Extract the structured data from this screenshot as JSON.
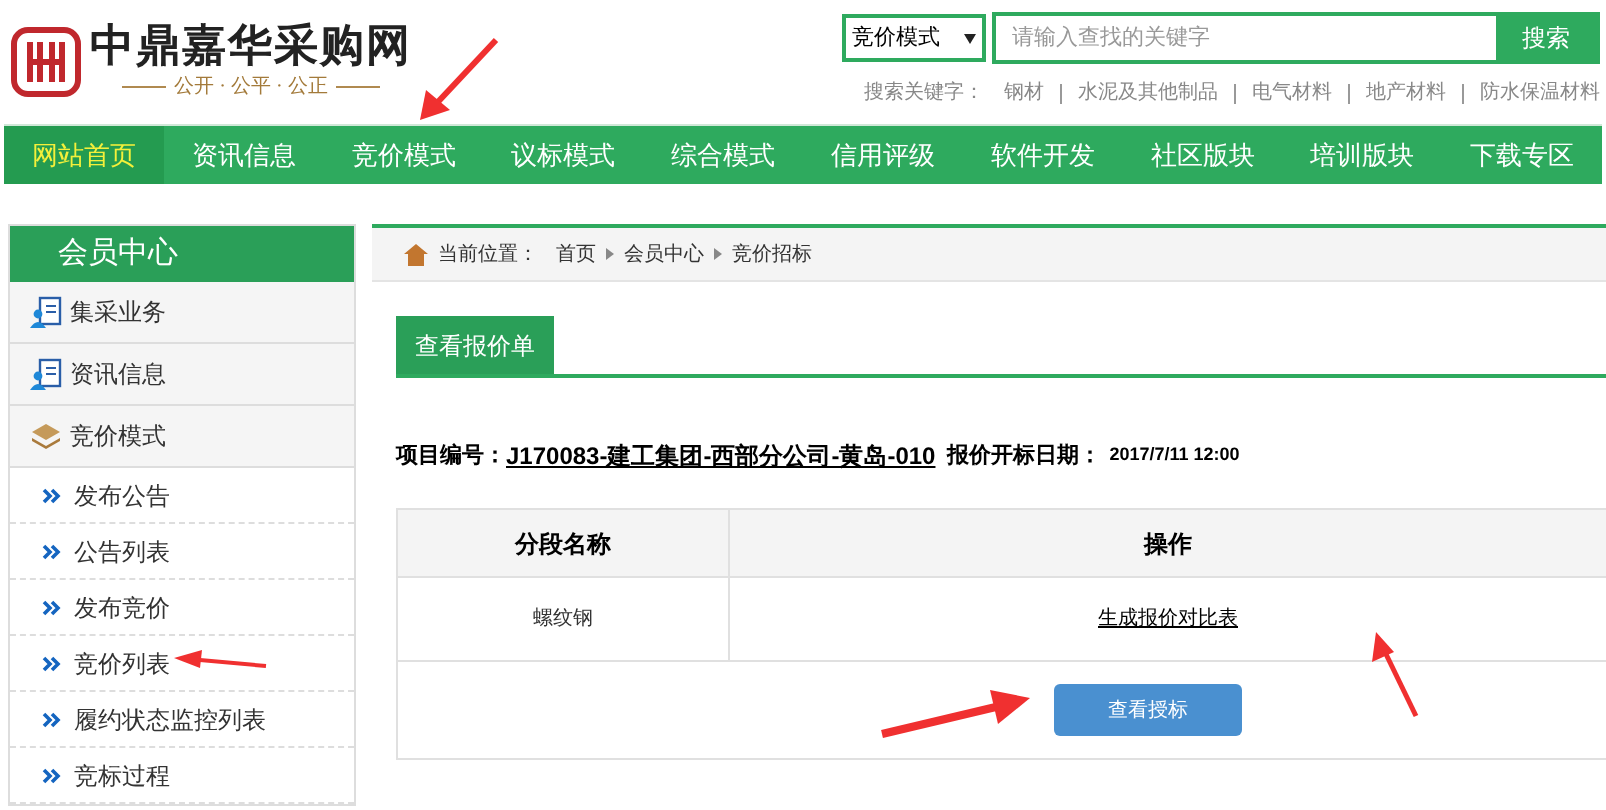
{
  "header": {
    "logo_text": "中鼎嘉华采购网",
    "slogan": "公开 · 公平 · 公正"
  },
  "search": {
    "mode": "竞价模式",
    "placeholder": "请输入查找的关键字",
    "button": "搜索",
    "keywords_label": "搜索关键字：",
    "keywords": [
      "钢材",
      "水泥及其他制品",
      "电气材料",
      "地产材料",
      "防水保温材料"
    ]
  },
  "nav": [
    {
      "label": "网站首页",
      "selected": true
    },
    {
      "label": "资讯信息",
      "selected": false
    },
    {
      "label": "竞价模式",
      "selected": false
    },
    {
      "label": "议标模式",
      "selected": false
    },
    {
      "label": "综合模式",
      "selected": false
    },
    {
      "label": "信用评级",
      "selected": false
    },
    {
      "label": "软件开发",
      "selected": false
    },
    {
      "label": "社区版块",
      "selected": false
    },
    {
      "label": "培训版块",
      "selected": false
    },
    {
      "label": "下载专区",
      "selected": false
    }
  ],
  "sidebar": {
    "title": "会员中心",
    "items": [
      {
        "label": "集采业务"
      },
      {
        "label": "资讯信息"
      },
      {
        "label": "竞价模式",
        "children": [
          {
            "label": "发布公告"
          },
          {
            "label": "公告列表"
          },
          {
            "label": "发布竞价"
          },
          {
            "label": "竞价列表"
          },
          {
            "label": "履约状态监控列表"
          },
          {
            "label": "竞标过程"
          }
        ]
      }
    ]
  },
  "breadcrumb": {
    "label": "当前位置：",
    "items": [
      "首页",
      "会员中心",
      "竞价招标"
    ]
  },
  "tabs": [
    {
      "label": "查看报价单",
      "selected": true
    }
  ],
  "project": {
    "number_label": "项目编号：",
    "number": "J170083-建工集团-西部分公司-黄岛-010",
    "date_label": "报价开标日期：",
    "date": "2017/7/11 12:00"
  },
  "table": {
    "columns": [
      "分段名称",
      "操作"
    ],
    "rows": [
      {
        "name": "螺纹钢",
        "action": "生成报价对比表"
      }
    ],
    "button": "查看授标"
  }
}
